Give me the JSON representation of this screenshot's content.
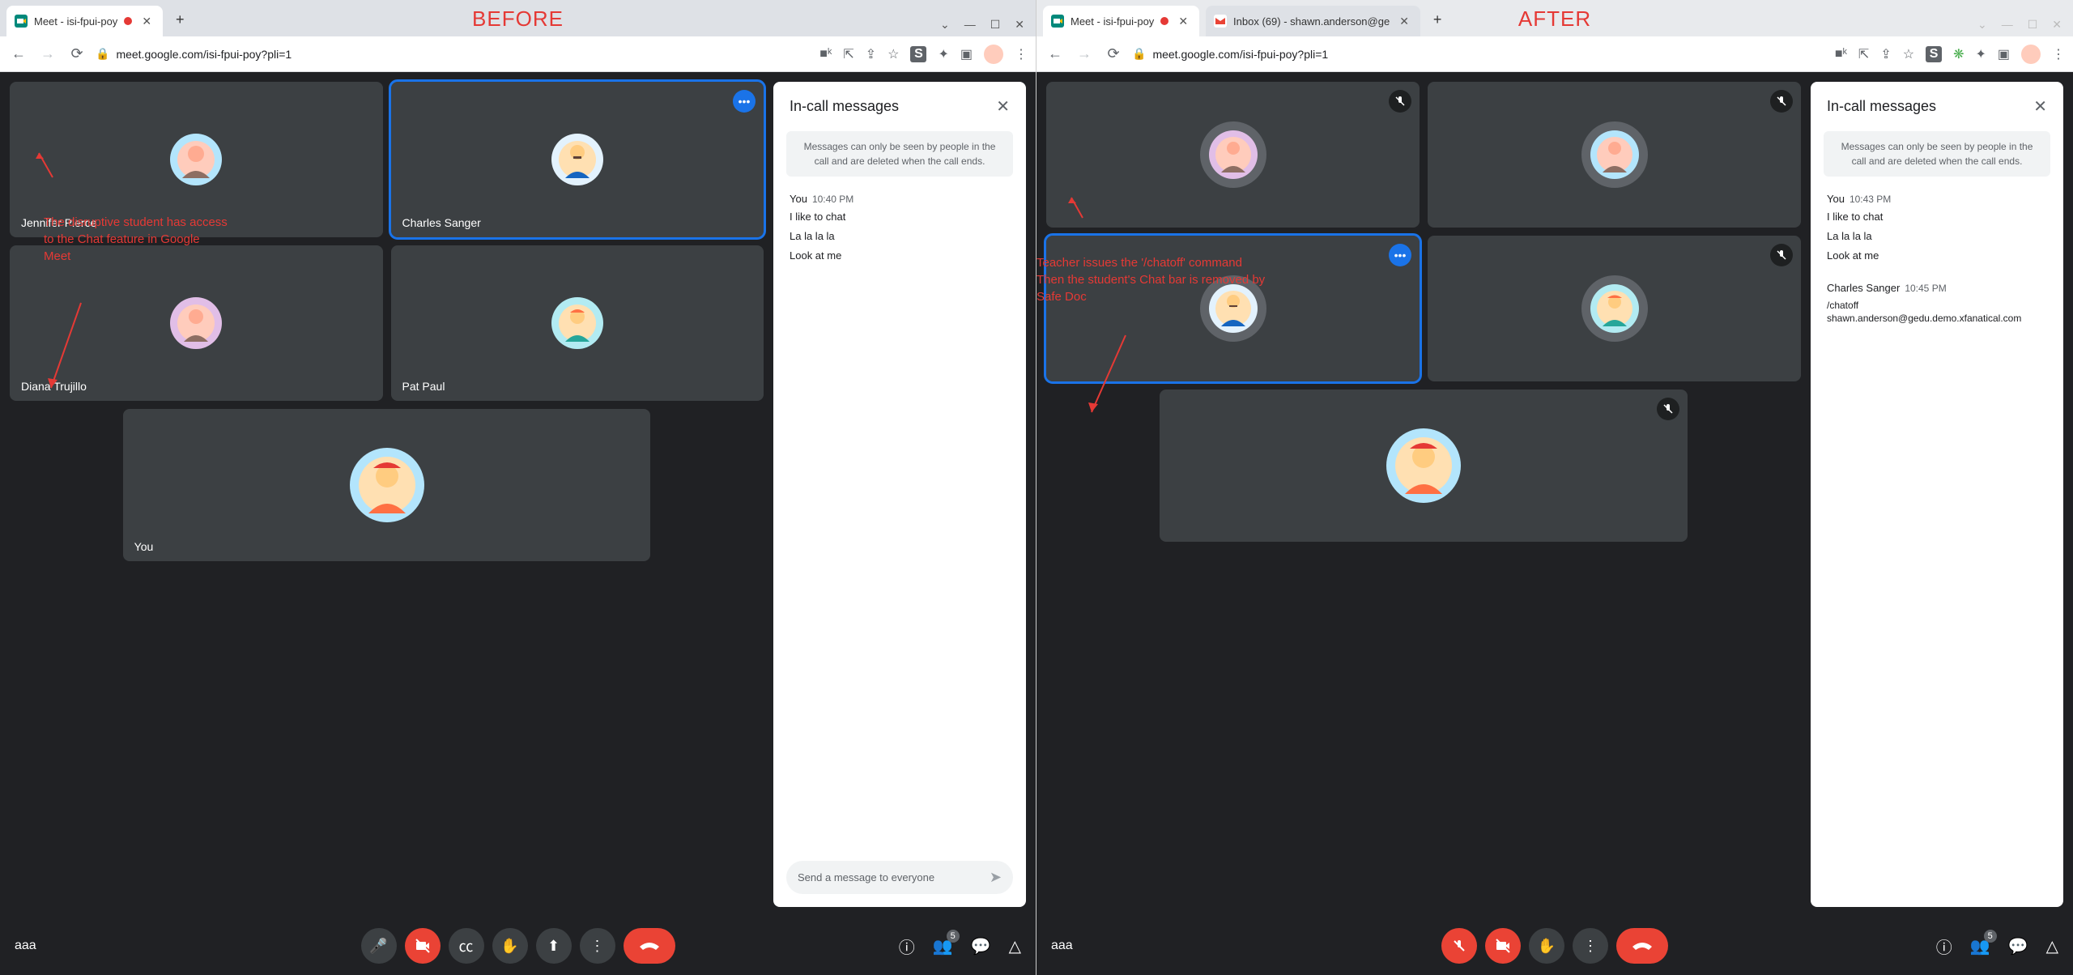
{
  "labels": {
    "before": "BEFORE",
    "after": "AFTER"
  },
  "url": "meet.google.com/isi-fpui-poy?pli=1",
  "tabs": {
    "left": [
      {
        "title": "Meet - isi-fpui-poy"
      }
    ],
    "right": [
      {
        "title": "Meet - isi-fpui-poy"
      },
      {
        "title": "Inbox (69) - shawn.anderson@ge"
      }
    ]
  },
  "participants": {
    "before": {
      "row1": [
        {
          "name": "Jennifer Pierce"
        },
        {
          "name": "Charles Sanger",
          "active": true,
          "pinned": true
        }
      ],
      "row2": [
        {
          "name": "Diana Trujillo"
        },
        {
          "name": "Pat Paul"
        }
      ],
      "row3": [
        {
          "name": "You"
        }
      ]
    }
  },
  "chat": {
    "title": "In-call messages",
    "notice": "Messages can only be seen by people in the call and are deleted when the call ends.",
    "input_placeholder": "Send a message to everyone",
    "before": {
      "msgs": [
        {
          "author": "You",
          "time": "10:40 PM",
          "lines": [
            "I like to chat",
            "La la la la",
            "Look at me"
          ]
        }
      ]
    },
    "after": {
      "msgs": [
        {
          "author": "You",
          "time": "10:43 PM",
          "lines": [
            "I like to chat",
            "La la la la",
            "Look at me"
          ]
        },
        {
          "author": "Charles Sanger",
          "time": "10:45 PM",
          "lines": [
            "/chatoff shawn.anderson@gedu.demo.xfanatical.com"
          ]
        }
      ]
    }
  },
  "dock": {
    "aaa": "aaa",
    "count": "5"
  },
  "annotations": {
    "before": "The disruptive student has access to the Chat feature in Google Meet",
    "after": "Teacher issues the '/chatoff' command\nThen the student's Chat bar is removed by Safe Doc"
  }
}
